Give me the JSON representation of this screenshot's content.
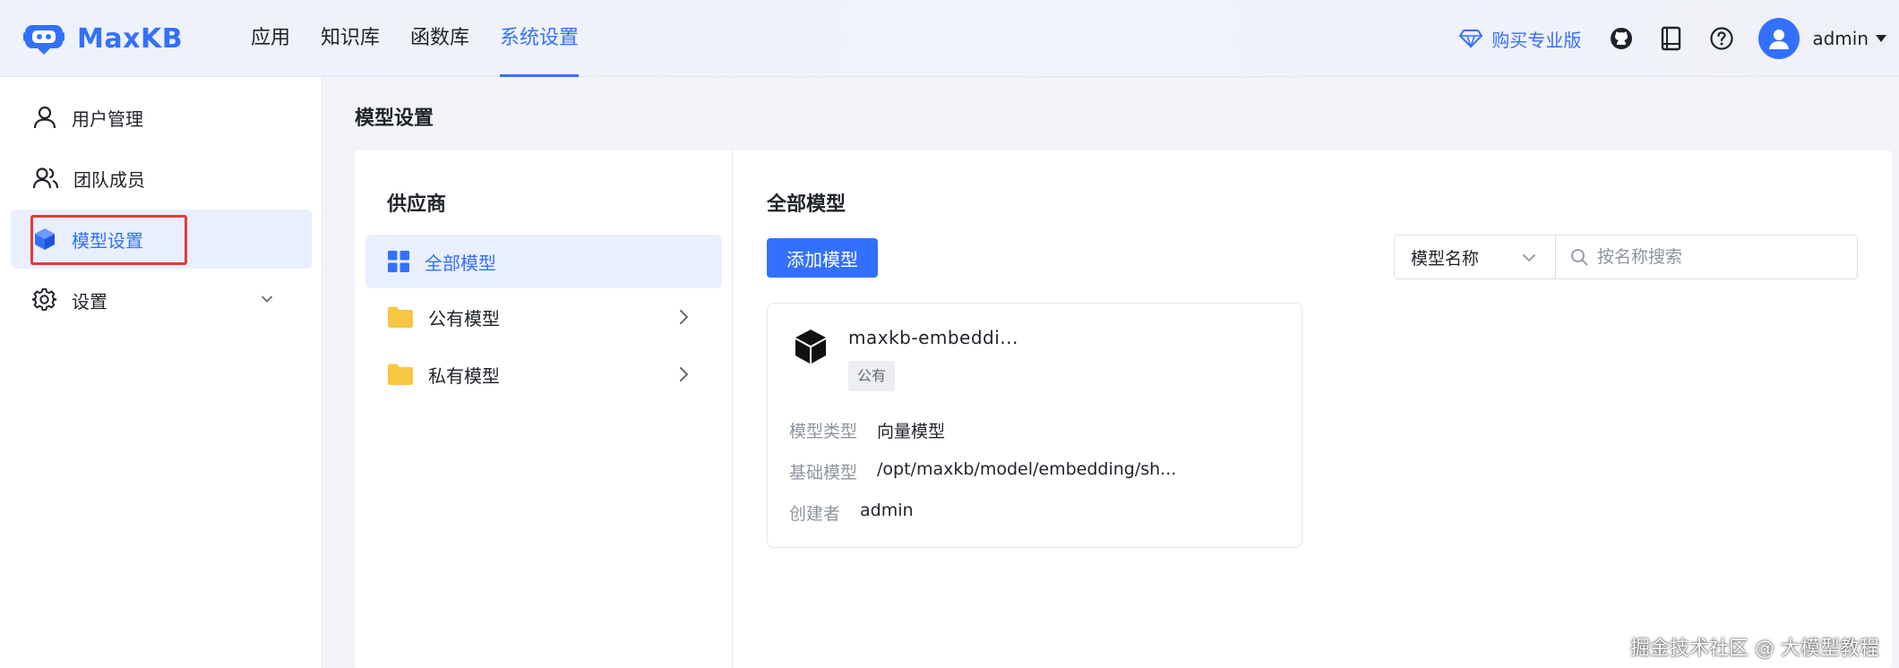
{
  "app": {
    "name": "MaxKB"
  },
  "nav": {
    "items": [
      {
        "label": "应用"
      },
      {
        "label": "知识库"
      },
      {
        "label": "函数库"
      },
      {
        "label": "系统设置"
      }
    ]
  },
  "header": {
    "buy_pro": "购买专业版",
    "username": "admin",
    "icons": [
      "diamond-icon",
      "github-icon",
      "book-icon",
      "help-icon",
      "avatar-icon",
      "caret-down-icon"
    ]
  },
  "sidebar": {
    "items": [
      {
        "label": "用户管理",
        "icon": "user-icon"
      },
      {
        "label": "团队成员",
        "icon": "team-icon"
      },
      {
        "label": "模型设置",
        "icon": "cube-icon"
      },
      {
        "label": "设置",
        "icon": "gear-icon"
      }
    ]
  },
  "page": {
    "title": "模型设置"
  },
  "providers": {
    "title": "供应商",
    "items": [
      {
        "label": "全部模型",
        "icon": "grid-icon"
      },
      {
        "label": "公有模型",
        "icon": "folder-icon"
      },
      {
        "label": "私有模型",
        "icon": "folder-icon"
      }
    ]
  },
  "models": {
    "title": "全部模型",
    "add_button": "添加模型",
    "search": {
      "select_value": "模型名称",
      "placeholder": "按名称搜索"
    },
    "cards": [
      {
        "name": "maxkb-embeddi...",
        "badge": "公有",
        "rows": [
          {
            "label": "模型类型",
            "value": "向量模型"
          },
          {
            "label": "基础模型",
            "value": "/opt/maxkb/model/embedding/sh..."
          },
          {
            "label": "创建者",
            "value": "admin"
          }
        ]
      }
    ]
  },
  "watermark": "掘金技术社区 @ 大模型教程",
  "colors": {
    "primary": "#3370ff",
    "highlight_box": "#e53935",
    "folder": "#f7c744"
  }
}
